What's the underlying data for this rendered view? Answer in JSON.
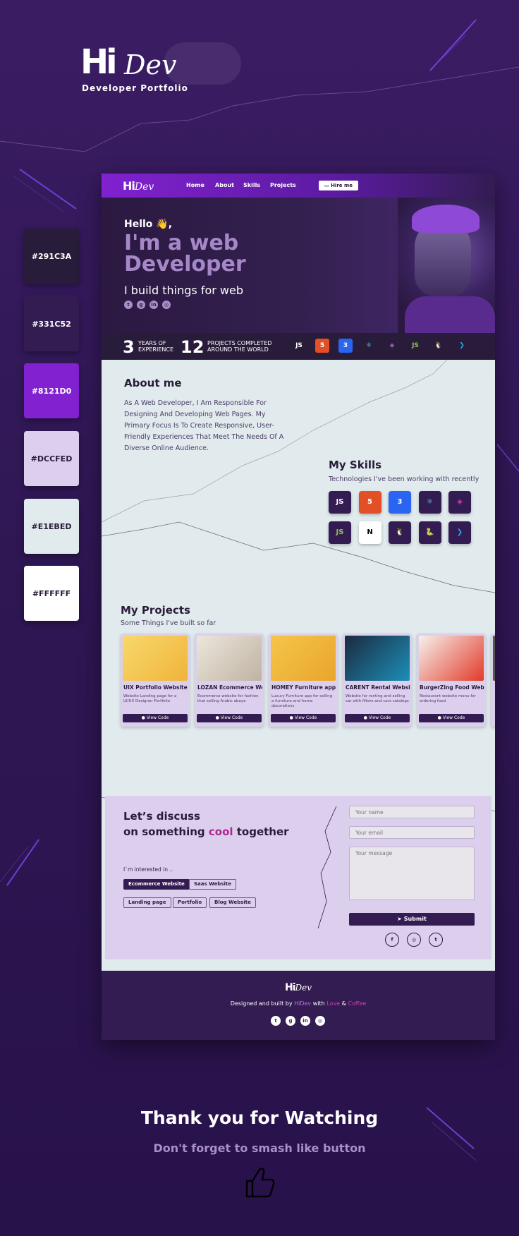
{
  "brand": {
    "hi": "Hi",
    "dev": "Dev",
    "tagline": "Developer Portfolio"
  },
  "palette": [
    {
      "label": "#291C3A",
      "color": "#291C3A",
      "text": "#ffffff"
    },
    {
      "label": "#331C52",
      "color": "#331C52",
      "text": "#ffffff"
    },
    {
      "label": "#8121D0",
      "color": "#8121D0",
      "text": "#ffffff"
    },
    {
      "label": "#DCCFED",
      "color": "#DCCFED",
      "text": "#291C3A"
    },
    {
      "label": "#E1EBED",
      "color": "#E1EBED",
      "text": "#291C3A"
    },
    {
      "label": "#FFFFFF",
      "color": "#FFFFFF",
      "text": "#291C3A"
    }
  ],
  "nav": {
    "logo_hi": "Hi",
    "logo_dev": "Dev",
    "links": [
      "Home",
      "About",
      "Skills",
      "Projects"
    ],
    "hire": "Hire me"
  },
  "hero": {
    "hello": "Hello 👋,",
    "title": "I'm a web Developer",
    "subtitle": "I build things for web",
    "socials": [
      "twitter-icon",
      "github-icon",
      "linkedin-icon",
      "instagram-icon"
    ]
  },
  "stats": {
    "years": "3",
    "years_label_1": "YEARS OF",
    "years_label_2": "EXPERIENCE",
    "projects": "12",
    "projects_label_1": "PROJECTS COMPLETED",
    "projects_label_2": "AROUND THE WORLD",
    "tech": [
      {
        "name": "js-icon",
        "glyph": "JS",
        "color": "#ffffff",
        "bg": "transparent"
      },
      {
        "name": "html5-icon",
        "glyph": "5",
        "color": "#ffffff",
        "bg": "#e34f26"
      },
      {
        "name": "css3-icon",
        "glyph": "3",
        "color": "#ffffff",
        "bg": "#2965f1"
      },
      {
        "name": "react-icon",
        "glyph": "⚛",
        "color": "#61dafb",
        "bg": "transparent"
      },
      {
        "name": "graphql-icon",
        "glyph": "◈",
        "color": "#b35fd6",
        "bg": "transparent"
      },
      {
        "name": "nodejs-icon",
        "glyph": "JS",
        "color": "#8cc84b",
        "bg": "transparent"
      },
      {
        "name": "linux-icon",
        "glyph": "🐧",
        "color": "#ffffff",
        "bg": "transparent"
      },
      {
        "name": "vscode-icon",
        "glyph": "❯",
        "color": "#23a9f2",
        "bg": "transparent"
      }
    ]
  },
  "about": {
    "title": "About me",
    "text": "As A Web Developer, I Am Responsible For Designing And Developing Web Pages. My Primary Focus Is To Create Responsive, User-Friendly Experiences That Meet The Needs Of A Diverse Online Audience."
  },
  "skills": {
    "title": "My Skills",
    "subtitle": "Technologies I've been working with recently",
    "items": [
      {
        "name": "js-icon",
        "glyph": "JS",
        "color": "#ffffff",
        "bg": "#331C52"
      },
      {
        "name": "html5-icon",
        "glyph": "5",
        "color": "#ffffff",
        "bg": "#e34f26"
      },
      {
        "name": "css3-icon",
        "glyph": "3",
        "color": "#ffffff",
        "bg": "#2965f1"
      },
      {
        "name": "react-icon",
        "glyph": "⚛",
        "color": "#61dafb",
        "bg": "#331C52"
      },
      {
        "name": "graphql-icon",
        "glyph": "◈",
        "color": "#e535ab",
        "bg": "#331C52"
      },
      {
        "name": "nodejs-icon",
        "glyph": "JS",
        "color": "#8cc84b",
        "bg": "#331C52"
      },
      {
        "name": "nextjs-icon",
        "glyph": "N",
        "color": "#000000",
        "bg": "#ffffff"
      },
      {
        "name": "linux-icon",
        "glyph": "🐧",
        "color": "#ffffff",
        "bg": "#331C52"
      },
      {
        "name": "python-icon",
        "glyph": "🐍",
        "color": "#ffd43b",
        "bg": "#331C52"
      },
      {
        "name": "vscode-icon",
        "glyph": "❯",
        "color": "#23a9f2",
        "bg": "#331C52"
      }
    ]
  },
  "projects": {
    "title": "My Projects",
    "subtitle": "Some Things I've built so far",
    "cards": [
      {
        "title": "UIX Portfolio Website",
        "desc": "Website Landing page for a UI/UX Designer Portfolio",
        "btn": "View Code",
        "thumb": "#f5cf5a"
      },
      {
        "title": "LOZAN Ecommerce Web",
        "desc": "Ecommerce website for fashion that selling Arabic abaya",
        "btn": "View Code",
        "thumb": "#e8e1d6"
      },
      {
        "title": "HOMEY Furniture app",
        "desc": "Luxury Furniture app for selling a furniture and home decorations",
        "btn": "View Code",
        "thumb": "#f2b93b"
      },
      {
        "title": "CARENT Rental Website",
        "desc": "Website for renting and selling car with filters and cars catalogs",
        "btn": "View Code",
        "thumb": "#1b2a3e"
      },
      {
        "title": "BurgerZing Food Website",
        "desc": "Restaurant website menu for ordering food",
        "btn": "View Code",
        "thumb": "#f4f0ec"
      }
    ]
  },
  "contact": {
    "line1": "Let’s discuss",
    "line2_pre": "on something ",
    "line2_cool": "cool",
    "line2_post": " together",
    "interested": "I`m interested in ..",
    "chips": [
      "Ecommerce Website",
      "Saas Website",
      "Landing page",
      "Portfolio",
      "Blog Website"
    ],
    "name_ph": "Your name",
    "email_ph": "Your email",
    "msg_ph": "Your message",
    "submit": "Submit"
  },
  "footer": {
    "logo_hi": "Hi",
    "logo_dev": "Dev",
    "text_pre": "Designed and built by ",
    "hidev": "HiDev",
    "with": " with ",
    "love": "Love",
    "amp": " & ",
    "coffee": "Coffee"
  },
  "outro": {
    "thanks": "Thank you for Watching",
    "smash": "Don't forget to smash like button"
  }
}
